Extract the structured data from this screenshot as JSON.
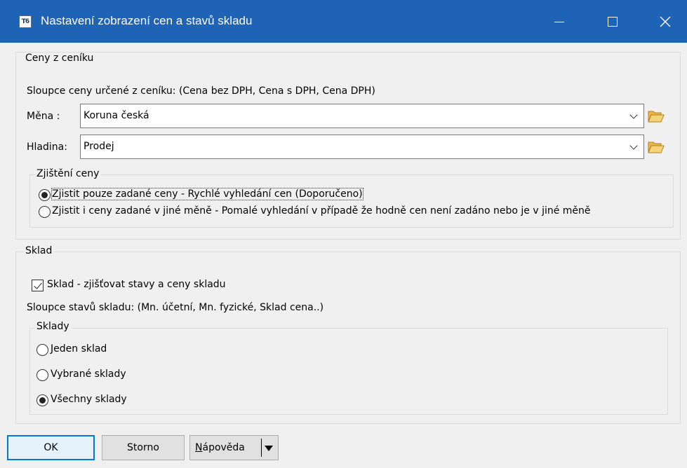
{
  "window": {
    "title": "Nastavení zobrazení cen a stavů skladu",
    "icon": "T6-app-icon"
  },
  "prices": {
    "group_label": "Ceny z ceníku",
    "columns_text": "Sloupce ceny určené z ceníku: (Cena bez DPH, Cena s DPH, Cena DPH)",
    "currency_label": "Měna :",
    "currency_value": "Koruna česká",
    "level_label": "Hladina:",
    "level_value": "Prodej",
    "detection": {
      "group_label": "Zjištění ceny",
      "options": [
        {
          "label": "Zjistit pouze zadané ceny - Rychlé vyhledání cen  (Doporučeno)",
          "checked": true
        },
        {
          "label": "Zjistit i ceny zadané v jiné měně - Pomalé vyhledání v případě že hodně cen není zadáno nebo je v jiné měně",
          "checked": false
        }
      ]
    }
  },
  "stock": {
    "group_label": "Sklad",
    "checkbox_label": "Sklad - zjišťovat stavy a ceny skladu",
    "checkbox_checked": true,
    "columns_text": "Sloupce stavů skladu: (Mn. účetní, Mn. fyzické, Sklad cena..)",
    "warehouses": {
      "group_label": "Sklady",
      "options": [
        {
          "label": "Jeden sklad",
          "checked": false
        },
        {
          "label": "Vybrané sklady",
          "checked": false
        },
        {
          "label": "Všechny sklady",
          "checked": true
        }
      ]
    }
  },
  "buttons": {
    "ok": "OK",
    "cancel": "Storno",
    "help_accel": "N",
    "help_rest": "ápověda"
  },
  "colors": {
    "titlebar": "#1f63b6",
    "background": "#f0f0f0",
    "default_button_border": "#0078d7"
  }
}
